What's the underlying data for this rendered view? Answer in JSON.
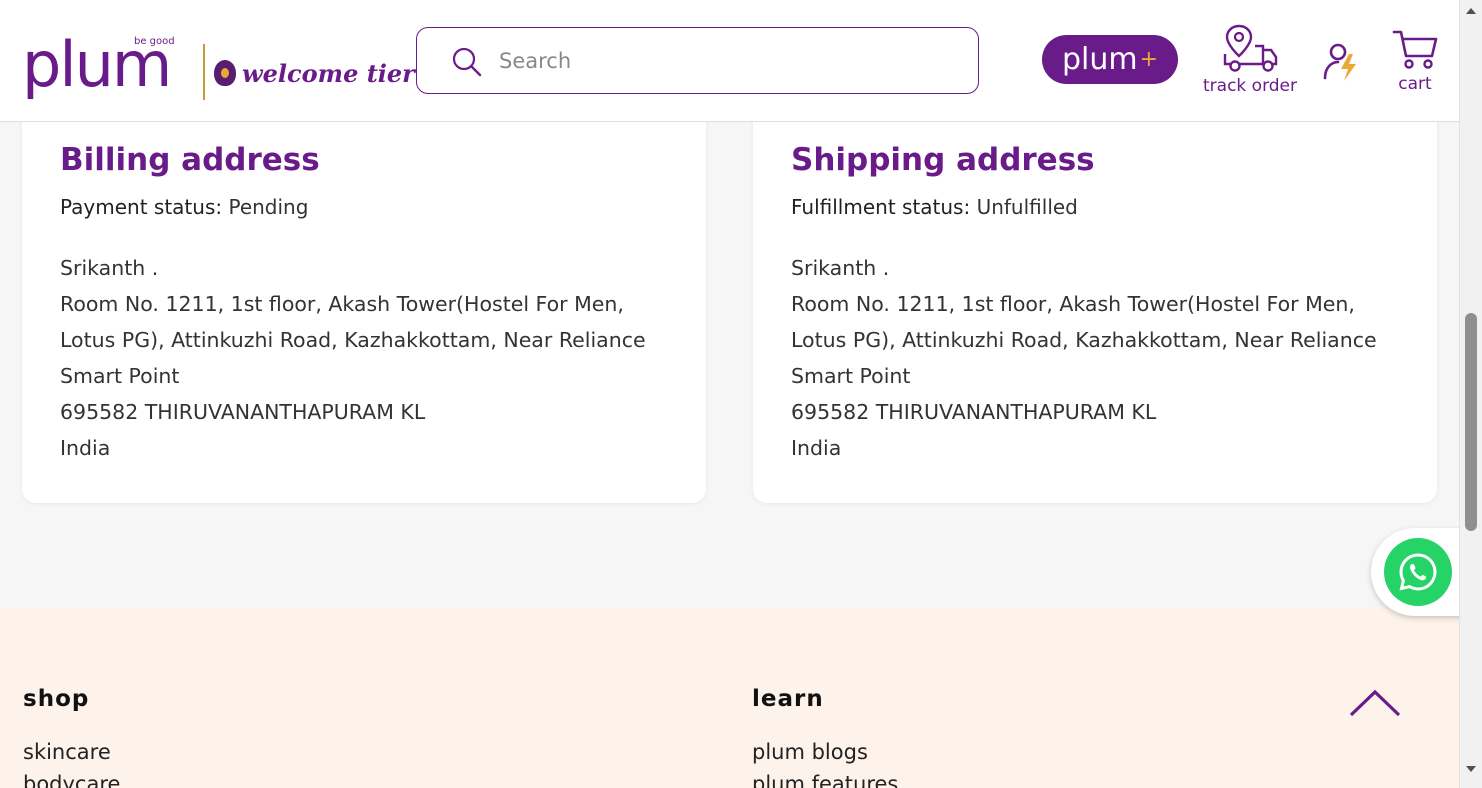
{
  "header": {
    "logo_text": "plum",
    "logo_tagline": "be good",
    "tier_label": "welcome tier",
    "search": {
      "placeholder": "Search",
      "value": ""
    },
    "plus_button": {
      "label": "plum",
      "suffix": "+"
    },
    "track_order_label": "track order",
    "cart_label": "cart"
  },
  "billing": {
    "title": "Billing address",
    "status_key": "Payment status:",
    "status_value": "Pending",
    "lines": [
      "Srikanth .",
      "Room No. 1211, 1st floor, Akash Tower(Hostel For Men,",
      "Lotus PG), Attinkuzhi Road, Kazhakkottam, Near Reliance",
      "Smart Point",
      "695582 THIRUVANANTHAPURAM KL",
      "India"
    ]
  },
  "shipping": {
    "title": "Shipping address",
    "status_key": "Fulfillment status:",
    "status_value": "Unfulfilled",
    "lines": [
      "Srikanth .",
      "Room No. 1211, 1st floor, Akash Tower(Hostel For Men,",
      "Lotus PG), Attinkuzhi Road, Kazhakkottam, Near Reliance",
      "Smart Point",
      "695582 THIRUVANANTHAPURAM KL",
      "India"
    ]
  },
  "footer": {
    "shop": {
      "heading": "shop",
      "links": [
        "skincare",
        "bodycare"
      ]
    },
    "learn": {
      "heading": "learn",
      "links": [
        "plum blogs",
        "plum features"
      ]
    }
  },
  "colors": {
    "brand_purple": "#6a1b8a",
    "gold": "#e8a936",
    "footer_bg": "#fdf3ea",
    "whatsapp_green": "#25d366"
  },
  "icons": [
    "search-icon",
    "truck-location-icon",
    "profile-icon",
    "cart-icon",
    "chevron-up-icon",
    "whatsapp-icon"
  ]
}
